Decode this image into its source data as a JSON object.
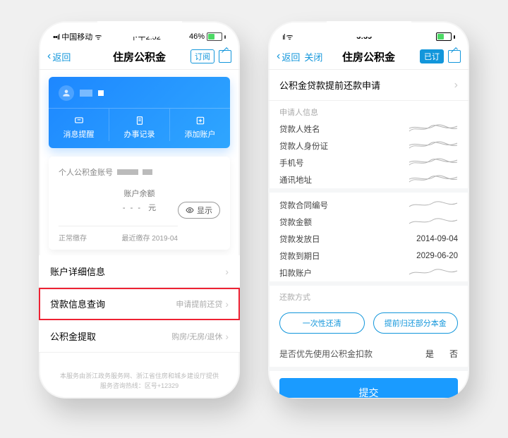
{
  "left": {
    "status": {
      "carrier": "中国移动",
      "time": "下午2:52",
      "battery": "46%"
    },
    "nav": {
      "back": "返回",
      "title": "住房公积金",
      "subscribe": "订阅"
    },
    "hero_tabs": [
      {
        "label": "消息提醒"
      },
      {
        "label": "办事记录"
      },
      {
        "label": "添加账户"
      }
    ],
    "card": {
      "acct_label": "个人公积金账号",
      "balance_label": "账户余额",
      "unit": "元",
      "show": "显示",
      "status": "正常缴存",
      "last": "最近缴存 2019-04"
    },
    "list": [
      {
        "title": "账户详细信息",
        "hint": ""
      },
      {
        "title": "贷款信息查询",
        "hint": "申请提前还贷",
        "hl": true
      },
      {
        "title": "公积金提取",
        "hint": "购房/无房/退休"
      }
    ],
    "footer": {
      "l1": "本服务由浙江政务服务网、浙江省住房和城乡建设厅提供",
      "l2": "服务咨询热线：区号+12329"
    }
  },
  "right": {
    "status": {
      "time": "3:39"
    },
    "nav": {
      "back": "返回",
      "close": "关闭",
      "title": "住房公积金",
      "subscribed": "已订"
    },
    "header": "公积金贷款提前还款申请",
    "applicant_section": "申请人信息",
    "applicant_fields": [
      "贷款人姓名",
      "贷款人身份证",
      "手机号",
      "通讯地址"
    ],
    "loan_fields": [
      {
        "k": "贷款合同编号",
        "v": ""
      },
      {
        "k": "贷款金额",
        "v": ""
      },
      {
        "k": "贷款发放日",
        "v": "2014-09-04"
      },
      {
        "k": "贷款到期日",
        "v": "2029-06-20"
      },
      {
        "k": "扣款账户",
        "v": ""
      }
    ],
    "method_section": "还款方式",
    "options": [
      "一次性还清",
      "提前归还部分本金"
    ],
    "priority_label": "是否优先使用公积金扣款",
    "priority_opts": [
      "是",
      "否"
    ],
    "submit": "提交"
  }
}
